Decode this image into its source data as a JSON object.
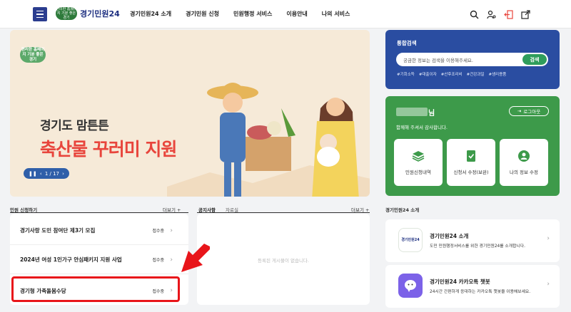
{
  "header": {
    "logo_badge": "편리한 홈페이지 기분 좋은 경기",
    "logo_text": "경기민원24",
    "nav": [
      "경기민원24 소개",
      "경기민원 신청",
      "민원행정 서비스",
      "이용안내",
      "나의 서비스"
    ]
  },
  "banner": {
    "badge": "편리한 홈페이지 기분 좋은 경기",
    "subtitle": "경기도 맘튼튼",
    "title": "축산물 꾸러미 지원",
    "pager": "1 / 17"
  },
  "search": {
    "title": "통합검색",
    "placeholder": "궁금한 정보는 검색을 이용해주세요.",
    "button": "검색",
    "tags": [
      "#기회소득",
      "#대출이자",
      "#산후조리비",
      "#건강과일",
      "#생리용품"
    ]
  },
  "user": {
    "name_suffix": "님",
    "logout": "로그아웃",
    "thanks": "함께해 주셔서 감사합니다.",
    "cards": [
      {
        "label": "민원신청내역",
        "icon": "stack-icon"
      },
      {
        "label": "신청서 수정(보완)",
        "icon": "document-check-icon"
      },
      {
        "label": "나의 정보 수정",
        "icon": "person-icon"
      }
    ]
  },
  "apply": {
    "title": "민원 신청하기",
    "more": "더보기 +",
    "items": [
      {
        "title": "경기사랑 도민 참여단 제3기 모집",
        "status": "접수중"
      },
      {
        "title": "2024년 여성 1인가구 안심패키지 지원 사업",
        "status": "접수중"
      },
      {
        "title": "경기형 가족돌봄수당",
        "status": "접수중"
      }
    ]
  },
  "notice": {
    "tab_notice": "공지사항",
    "tab_data": "자료실",
    "more": "더보기 +",
    "empty": "등록된 게시물이 없습니다."
  },
  "intro": {
    "title": "경기민원24 소개",
    "items": [
      {
        "title": "경기민원24 소개",
        "desc": "도민 민원행정서비스를 위한 경기민원24를 소개합니다.",
        "icon_text": "경기민원24"
      },
      {
        "title": "경기민원24 카카오톡 챗봇",
        "desc": "24시간 간편하게 응대하는 카카오톡 챗봇을 이용해보세요.",
        "icon_text": ""
      }
    ]
  },
  "colors": {
    "brand_blue": "#2a4da1",
    "brand_green": "#3d9a4a",
    "highlight_red": "#e8151a",
    "banner_red": "#e8453c"
  }
}
